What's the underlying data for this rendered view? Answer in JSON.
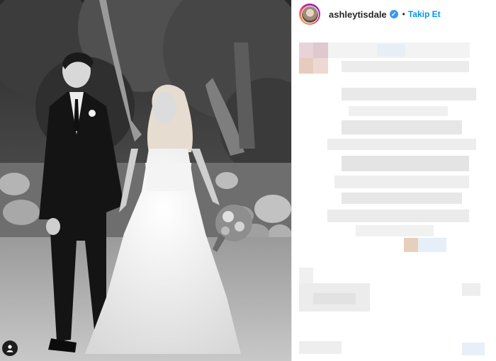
{
  "post": {
    "username": "ashleytisdale",
    "verified_glyph": "✓",
    "separator": "•",
    "follow_label": "Takip Et"
  },
  "icons": {
    "tag": "person-tag-icon",
    "verified": "verified-badge-icon"
  },
  "colors": {
    "follow": "#0095f6",
    "verified": "#3897f0"
  }
}
